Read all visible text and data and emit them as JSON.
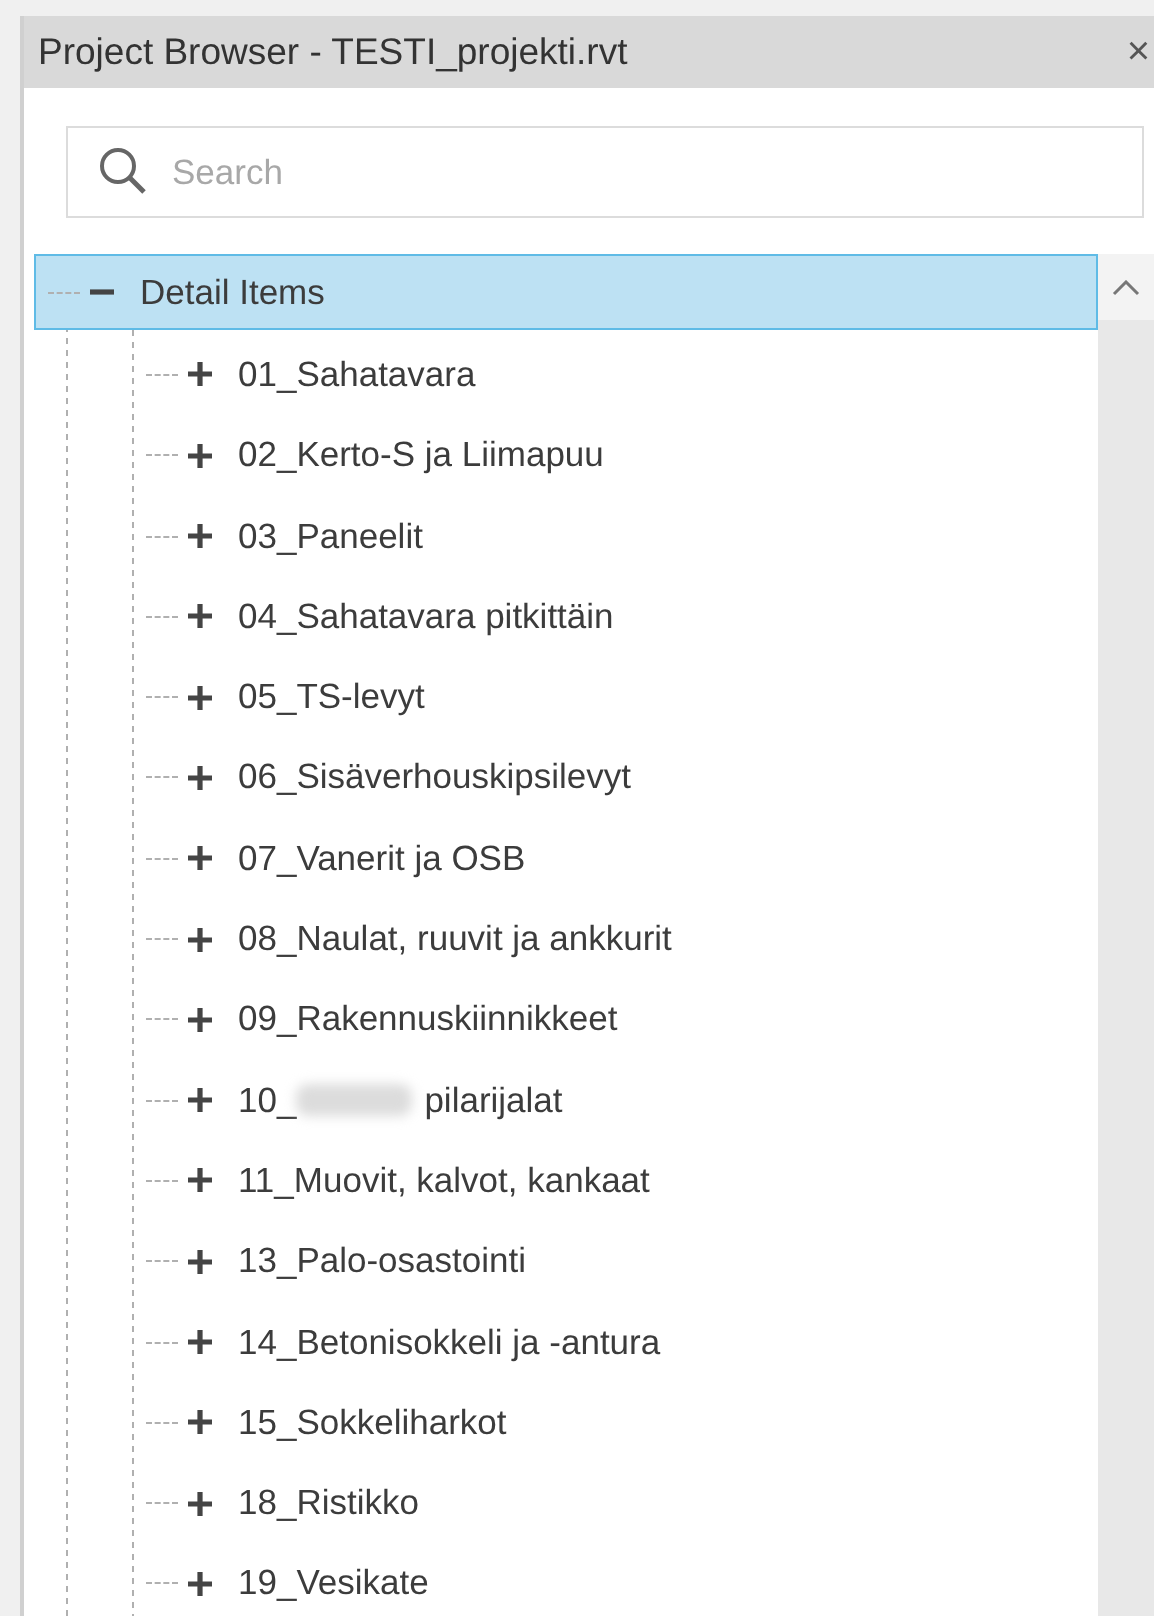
{
  "window": {
    "title": "Project Browser - TESTI_projekti.rvt",
    "close": "×"
  },
  "search": {
    "placeholder": "Search"
  },
  "tree": [
    {
      "label": "Detail Items",
      "expanded": true,
      "selected": true,
      "children": [
        {
          "label": "01_Sahatavara",
          "expanded": false,
          "selected": false
        },
        {
          "label": "02_Kerto-S ja Liimapuu",
          "expanded": false,
          "selected": false
        },
        {
          "label": "03_Paneelit",
          "expanded": false,
          "selected": false
        },
        {
          "label": "04_Sahatavara pitkittäin",
          "expanded": false,
          "selected": false
        },
        {
          "label": "05_TS-levyt",
          "expanded": false,
          "selected": false
        },
        {
          "label": "06_Sisäverhouskipsilevyt",
          "expanded": false,
          "selected": false
        },
        {
          "label": "07_Vanerit ja OSB",
          "expanded": false,
          "selected": false
        },
        {
          "label": "08_Naulat, ruuvit ja ankkurit",
          "expanded": false,
          "selected": false
        },
        {
          "label": "09_Rakennuskiinnikkeet",
          "expanded": false,
          "selected": false
        },
        {
          "label": "10_",
          "redacted": true,
          "label_after": "pilarijalat",
          "expanded": false,
          "selected": false
        },
        {
          "label": "11_Muovit, kalvot, kankaat",
          "expanded": false,
          "selected": false
        },
        {
          "label": "13_Palo-osastointi",
          "expanded": false,
          "selected": false
        },
        {
          "label": "14_Betonisokkeli ja -antura",
          "expanded": false,
          "selected": false
        },
        {
          "label": "15_Sokkeliharkot",
          "expanded": false,
          "selected": false
        },
        {
          "label": "18_Ristikko",
          "expanded": false,
          "selected": false
        },
        {
          "label": "19_Vesikate",
          "expanded": false,
          "selected": false
        }
      ]
    }
  ]
}
